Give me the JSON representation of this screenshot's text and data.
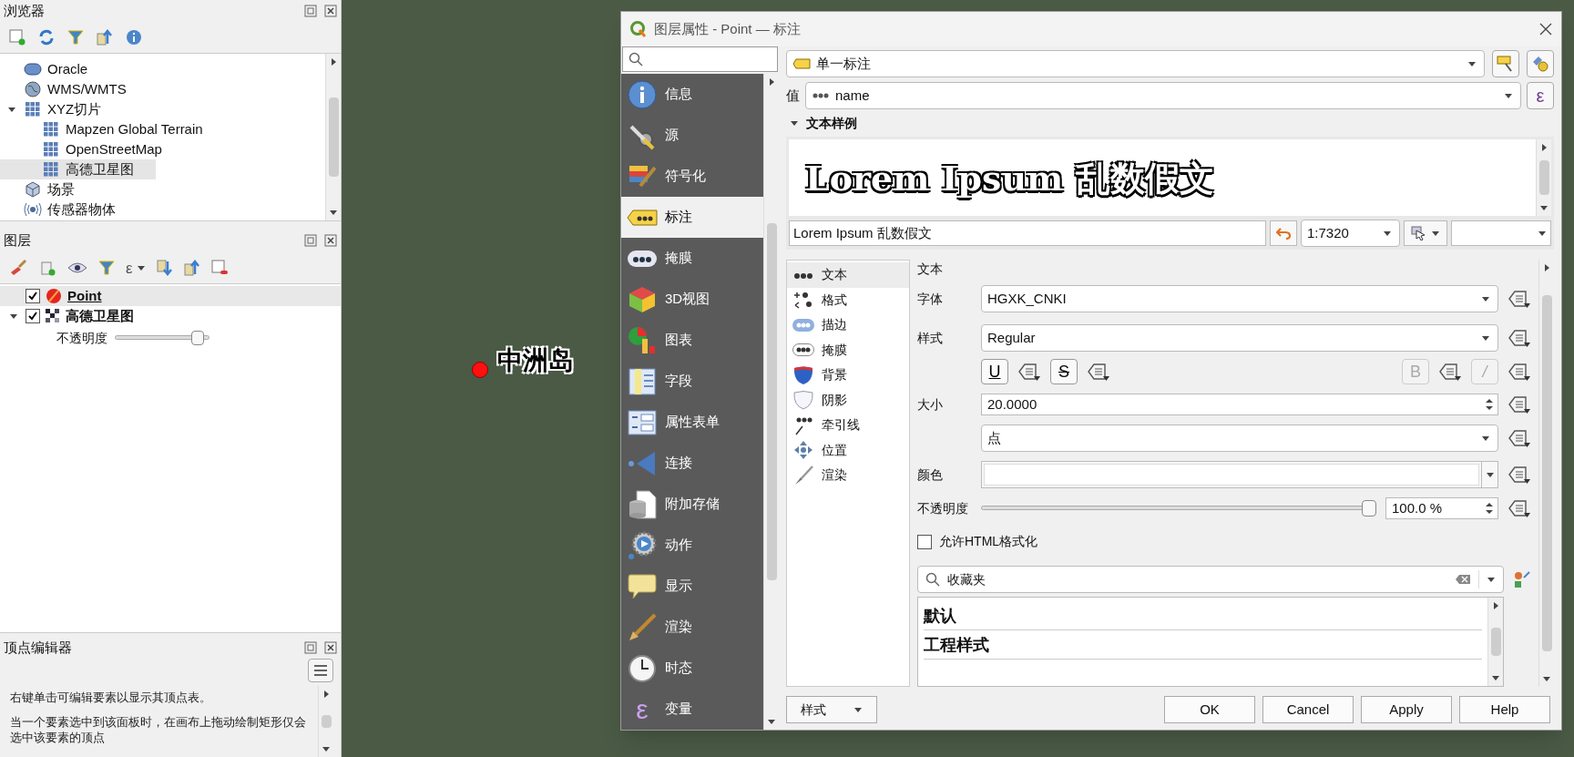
{
  "browser_panel": {
    "title": "浏览器",
    "items": [
      {
        "label": "Oracle",
        "selected": false
      },
      {
        "label": "WMS/WMTS",
        "selected": false
      },
      {
        "label": "XYZ切片",
        "selected": false,
        "expanded": true,
        "children": [
          {
            "label": "Mapzen Global Terrain",
            "selected": false
          },
          {
            "label": "OpenStreetMap",
            "selected": false
          },
          {
            "label": "高德卫星图",
            "selected": true
          }
        ]
      },
      {
        "label": "场景",
        "selected": false
      },
      {
        "label": "传感器物体",
        "selected": false
      }
    ]
  },
  "layers_panel": {
    "title": "图层",
    "expression_filter": "ε",
    "layers": [
      {
        "name": "Point",
        "checked": true,
        "selected": true
      },
      {
        "name": "高德卫星图",
        "checked": true,
        "selected": false,
        "expanded": true,
        "opacity": {
          "label": "不透明度",
          "level": 0.93
        }
      }
    ]
  },
  "vertex_editor": {
    "title": "顶点编辑器",
    "paragraphs": [
      "右键单击可编辑要素以显示其顶点表。",
      "当一个要素选中到该面板时，在画布上拖动绘制矩形仅会选中该要素的顶点"
    ]
  },
  "map": {
    "label": "中洲岛"
  },
  "dialog": {
    "title": "图层属性 - Point — 标注",
    "nav": [
      {
        "label": "信息",
        "selected": false
      },
      {
        "label": "源",
        "selected": false
      },
      {
        "label": "符号化",
        "selected": false
      },
      {
        "label": "标注",
        "selected": true
      },
      {
        "label": "掩膜",
        "selected": false
      },
      {
        "label": "3D视图",
        "selected": false
      },
      {
        "label": "图表",
        "selected": false
      },
      {
        "label": "字段",
        "selected": false
      },
      {
        "label": "属性表单",
        "selected": false
      },
      {
        "label": "连接",
        "selected": false
      },
      {
        "label": "附加存储",
        "selected": false
      },
      {
        "label": "动作",
        "selected": false
      },
      {
        "label": "显示",
        "selected": false
      },
      {
        "label": "渲染",
        "selected": false
      },
      {
        "label": "时态",
        "selected": false
      },
      {
        "label": "变量",
        "selected": false,
        "symbol": "ε"
      }
    ],
    "mode": "单一标注",
    "value_label": "值",
    "value_field": "name",
    "expression_button": "ε",
    "preview": {
      "title": "文本样例",
      "expanded": true,
      "text": "Lorem Ipsum 乱数假文",
      "sample": "Lorem Ipsum 乱数假文",
      "scale": "1:7320"
    },
    "subtabs": [
      {
        "label": "文本",
        "selected": true
      },
      {
        "label": "格式",
        "selected": false
      },
      {
        "label": "描边",
        "selected": false
      },
      {
        "label": "掩膜",
        "selected": false
      },
      {
        "label": "背景",
        "selected": false
      },
      {
        "label": "阴影",
        "selected": false
      },
      {
        "label": "牵引线",
        "selected": false
      },
      {
        "label": "位置",
        "selected": false
      },
      {
        "label": "渲染",
        "selected": false
      }
    ],
    "text_section": {
      "title": "文本",
      "font_label": "字体",
      "font": "HGXK_CNKI",
      "style_label": "样式",
      "style": "Regular",
      "style_buttons": [
        {
          "label": "U",
          "disabled": false
        },
        {
          "label": "S",
          "disabled": false
        },
        {
          "label": "B",
          "disabled": true
        },
        {
          "label": "/",
          "disabled": true
        }
      ],
      "size_label": "大小",
      "size": "20.0000",
      "unit": "点",
      "color_label": "颜色",
      "color": "#ffffff",
      "opacity": {
        "label": "不透明度",
        "level": 1,
        "reading": "100.0 %"
      },
      "html_label": "允许HTML格式化",
      "html_checked": false,
      "style_search": "收藏夹",
      "style_groups": [
        "默认",
        "工程样式"
      ]
    },
    "buttons": {
      "style": "样式",
      "ok": "OK",
      "cancel": "Cancel",
      "apply": "Apply",
      "help": "Help"
    }
  }
}
